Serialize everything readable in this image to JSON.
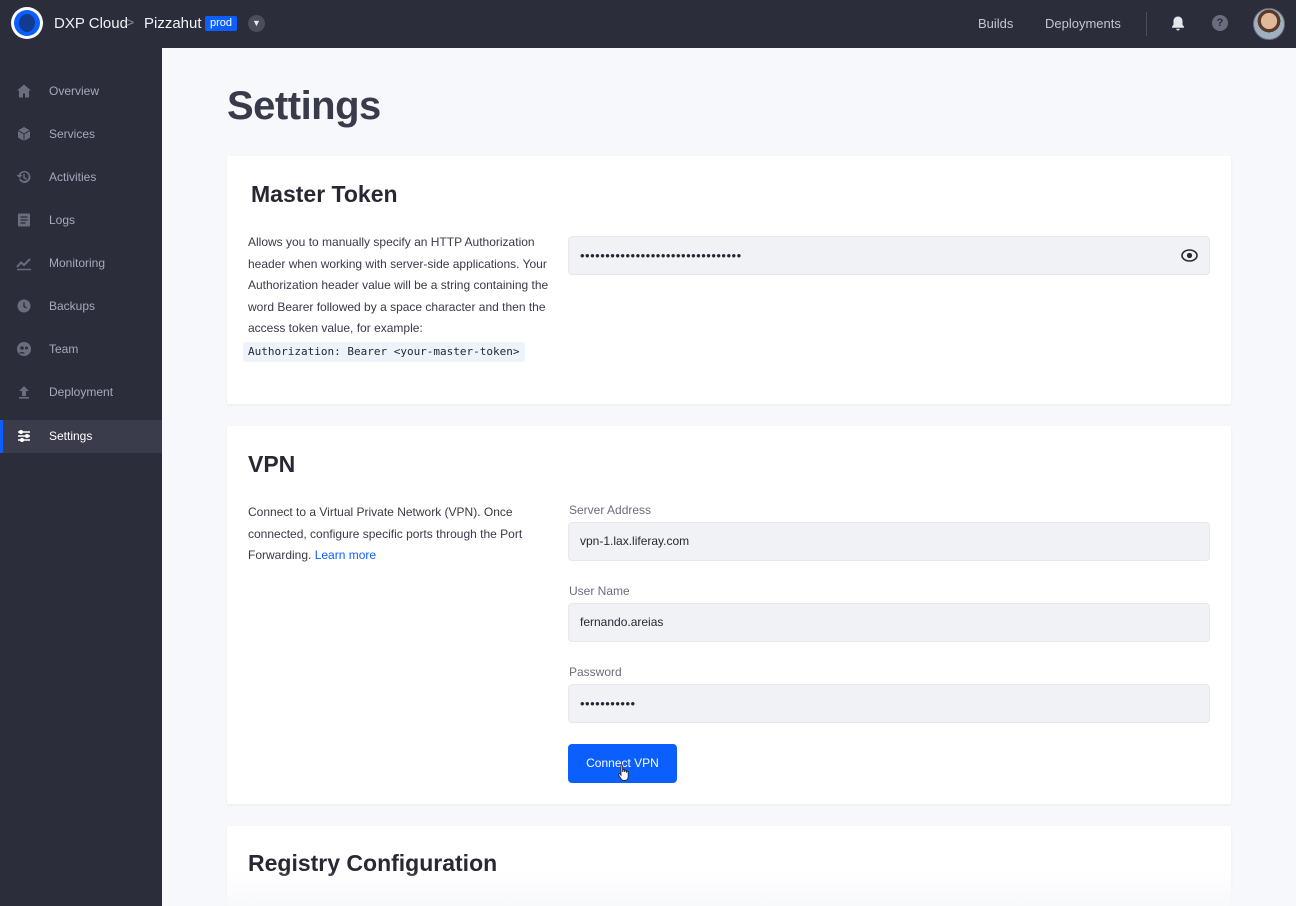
{
  "topbar": {
    "app_name": "DXP Cloud",
    "breadcrumb_separator": ">",
    "project": "Pizzahut",
    "environment": "prod",
    "links": [
      "Builds",
      "Deployments"
    ],
    "help_label": "?"
  },
  "sidebar": {
    "items": [
      {
        "label": "Overview",
        "icon": "home-icon"
      },
      {
        "label": "Services",
        "icon": "cube-icon"
      },
      {
        "label": "Activities",
        "icon": "history-icon"
      },
      {
        "label": "Logs",
        "icon": "logs-icon"
      },
      {
        "label": "Monitoring",
        "icon": "chart-icon"
      },
      {
        "label": "Backups",
        "icon": "backup-icon"
      },
      {
        "label": "Team",
        "icon": "team-icon"
      },
      {
        "label": "Deployment",
        "icon": "upload-icon"
      },
      {
        "label": "Settings",
        "icon": "sliders-icon",
        "active": true
      }
    ]
  },
  "page": {
    "title": "Settings"
  },
  "master_token": {
    "title": "Master Token",
    "description": "Allows you to manually specify an HTTP Authorization header when working with server-side applications. Your Authorization header value will be a string containing the word Bearer followed by a space character and then the access token value, for example:",
    "code_example": "Authorization: Bearer <your-master-token>",
    "token_value": "••••••••••••••••••••••••••••••••"
  },
  "vpn": {
    "title": "VPN",
    "description": "Connect to a Virtual Private Network (VPN). Once connected, configure specific ports through the Port Forwarding.",
    "learn_more": "Learn more",
    "server_label": "Server Address",
    "server_value": "vpn-1.lax.liferay.com",
    "user_label": "User Name",
    "user_value": "fernando.areias",
    "password_label": "Password",
    "password_value": "•••••••••••",
    "connect_label": "Connect VPN"
  },
  "registry": {
    "title": "Registry Configuration"
  },
  "colors": {
    "primary": "#0b5fff",
    "topbar_bg": "#2b2d3b",
    "page_bg": "#f7f8fb"
  }
}
